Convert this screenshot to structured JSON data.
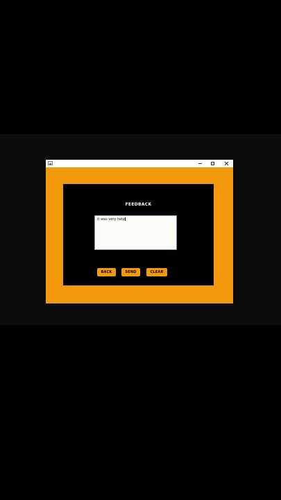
{
  "window": {
    "title": "",
    "controls": {
      "minimize_icon": "minimize-icon",
      "maximize_icon": "maximize-icon",
      "close_icon": "close-icon"
    }
  },
  "form": {
    "title": "FEEDBACK",
    "feedback_value": "it was very help",
    "buttons": {
      "back": "BACK",
      "send": "SEND",
      "clear": "CLEAR"
    }
  },
  "colors": {
    "frame": "#f39a0c",
    "panel": "#000000",
    "button": "#f39a0c",
    "title_text": "#ffffff"
  }
}
